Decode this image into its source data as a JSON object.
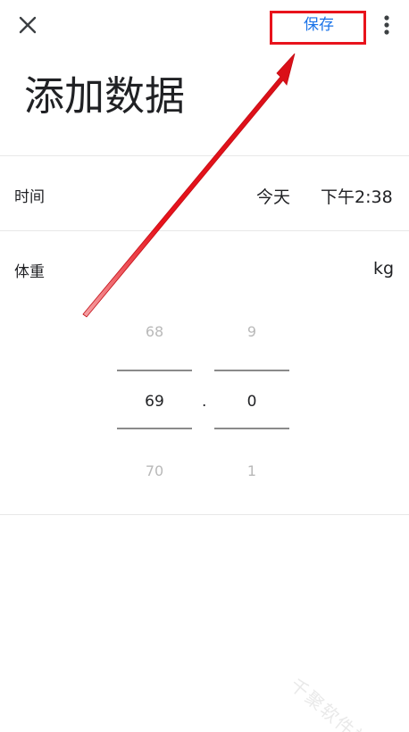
{
  "topbar": {
    "close_icon": "close-icon",
    "save_label": "保存",
    "more_icon": "more-vert-icon"
  },
  "title": "添加数据",
  "time_row": {
    "label": "时间",
    "date": "今天",
    "time": "下午2:38"
  },
  "weight_row": {
    "label": "体重",
    "unit": "kg"
  },
  "picker": {
    "integer": {
      "prev": "68",
      "current": "69",
      "next": "70"
    },
    "separator": ".",
    "decimal": {
      "prev": "9",
      "current": "0",
      "next": "1"
    }
  },
  "watermark": "千聚软件站",
  "colors": {
    "accent": "#1a73e8",
    "annotation": "#e8131c"
  }
}
